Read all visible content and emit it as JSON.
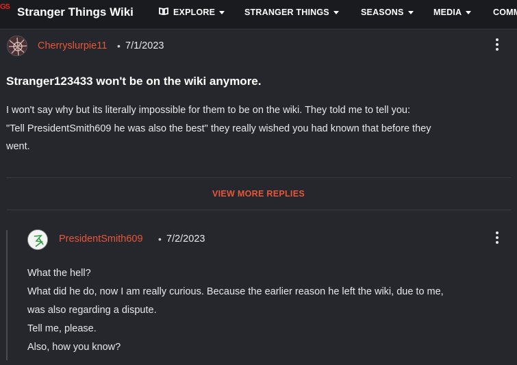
{
  "header": {
    "logo_text": "GS",
    "wiki_title": "Stranger Things Wiki",
    "nav": [
      {
        "label": "EXPLORE",
        "icon": "book-icon"
      },
      {
        "label": "STRANGER THINGS"
      },
      {
        "label": "SEASONS"
      },
      {
        "label": "MEDIA"
      },
      {
        "label": "COMM"
      }
    ]
  },
  "post": {
    "author": "Cherryslurpie11",
    "separator": "•",
    "date": "7/1/2023",
    "title": "Stranger123433 won't be on the wiki anymore.",
    "lines": [
      "I won't say why but its literally impossible for them to be on the wiki. They told me to tell you:",
      "\"Tell PresidentSmith609 he was also the best\" they really wished you had known that before they",
      "went."
    ]
  },
  "view_more_label": "VIEW MORE REPLIES",
  "reply": {
    "author": "PresidentSmith609",
    "separator": "•",
    "date": "7/2/2023",
    "lines": [
      "What the hell?",
      "What did he do, now I am really curious. Because the earlier reason he left the wiki, due to me,",
      "was also regarding a dispute.",
      "Tell me, please.",
      "Also, how you know?"
    ]
  },
  "colors": {
    "accent": "#e8563a",
    "background": "#26272c",
    "topbar": "#1a1b1f"
  }
}
